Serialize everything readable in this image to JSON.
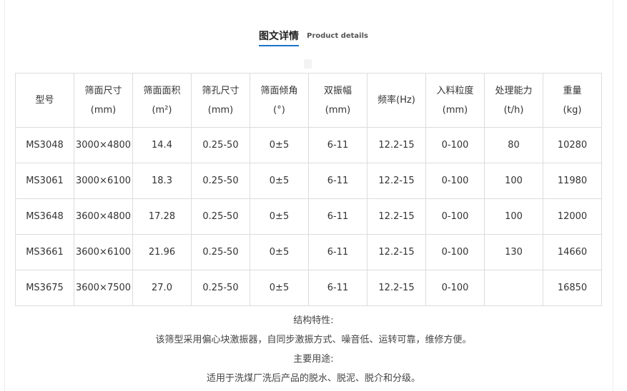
{
  "section_title": {
    "cn": "图文详情",
    "en": "Product details"
  },
  "table": {
    "headers": [
      {
        "line1": "型号",
        "line2": ""
      },
      {
        "line1": "筛面尺寸",
        "line2": "(mm)"
      },
      {
        "line1": "筛面面积",
        "line2": "(m²)"
      },
      {
        "line1": "筛孔尺寸",
        "line2": "(mm)"
      },
      {
        "line1": "筛面倾角",
        "line2": "(°)"
      },
      {
        "line1": "双振幅",
        "line2": "(mm)"
      },
      {
        "line1": "频率(Hz)",
        "line2": ""
      },
      {
        "line1": "入料粒度",
        "line2": "(mm)"
      },
      {
        "line1": "处理能力",
        "line2": "(t/h)"
      },
      {
        "line1": "重量",
        "line2": "(kg)"
      }
    ],
    "rows": [
      [
        "MS3048",
        "3000×4800",
        "14.4",
        "0.25-50",
        "0±5",
        "6-11",
        "12.2-15",
        "0-100",
        "80",
        "10280"
      ],
      [
        "MS3061",
        "3000×6100",
        "18.3",
        "0.25-50",
        "0±5",
        "6-11",
        "12.2-15",
        "0-100",
        "100",
        "11980"
      ],
      [
        "MS3648",
        "3600×4800",
        "17.28",
        "0.25-50",
        "0±5",
        "6-11",
        "12.2-15",
        "0-100",
        "100",
        "12000"
      ],
      [
        "MS3661",
        "3600×6100",
        "21.96",
        "0.25-50",
        "0±5",
        "6-11",
        "12.2-15",
        "0-100",
        "130",
        "14660"
      ],
      [
        "MS3675",
        "3600×7500",
        "27.0",
        "0.25-50",
        "0±5",
        "6-11",
        "12.2-15",
        "0-100",
        "",
        "16850"
      ]
    ]
  },
  "notes": {
    "structure_title": "结构特性:",
    "structure_text": "该筛型采用偏心块激振器，自同步激振方式、噪音低、运转可靠，维修方便。",
    "usage_title": "主要用途:",
    "usage_text": "适用于洗煤厂洗后产品的脱水、脱泥、脱介和分级。"
  }
}
